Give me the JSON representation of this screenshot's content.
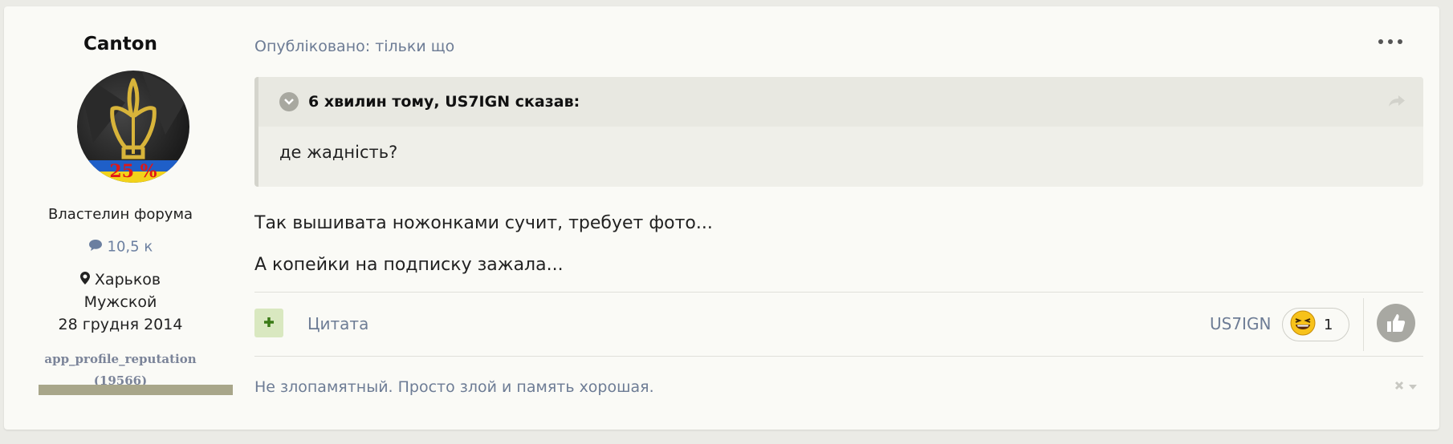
{
  "author": {
    "name": "Canton",
    "avatar_text": "25 %",
    "title": "Властелин форума",
    "posts": "10,5 к",
    "location": "Харьков",
    "gender": "Мужской",
    "joined": "28 грудня 2014",
    "reputation_label": "app_profile_reputation",
    "reputation_count": "(19566)"
  },
  "post": {
    "meta": "Опубліковано: тільки що",
    "quote": {
      "cite": "6 хвилин тому, US7IGN сказав:",
      "body": "де жадність?"
    },
    "lines": [
      "Так вышивата ножонками сучит, требует фото...",
      "А копейки на подписку зажала..."
    ],
    "quote_button_label": "Цитата",
    "reaction": {
      "user": "US7IGN",
      "count": "1",
      "icon": "laughing-emoji-icon"
    },
    "signature": "Не злопамятный. Просто злой и память хорошая."
  },
  "colors": {
    "accent_link": "#6d7c95",
    "reputation_bar": "#a8a68a",
    "quote_bg": "#efefe9",
    "plus_button_bg": "#d9e8c0"
  },
  "icons": [
    "comment-icon",
    "map-marker-icon",
    "ellipsis-icon",
    "chevron-down-icon",
    "share-icon",
    "plus-icon",
    "thumbs-up-icon",
    "close-icon",
    "caret-down-icon"
  ]
}
